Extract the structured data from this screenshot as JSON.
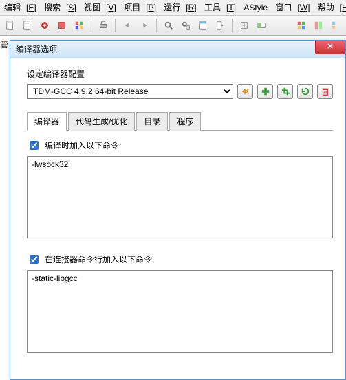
{
  "menus": {
    "edit": {
      "text": "编辑",
      "hot": "E"
    },
    "search": {
      "text": "搜索",
      "hot": "S"
    },
    "view": {
      "text": "视图",
      "hot": "V"
    },
    "project": {
      "text": "项目",
      "hot": "P"
    },
    "run": {
      "text": "运行",
      "hot": "R"
    },
    "tools": {
      "text": "工具",
      "hot": "T"
    },
    "astyle": {
      "text": "AStyle",
      "hot": ""
    },
    "window": {
      "text": "窗口",
      "hot": "W"
    },
    "help": {
      "text": "帮助",
      "hot": "H"
    }
  },
  "left_sliver": "管",
  "dialog": {
    "title": "编译器选项",
    "config_label": "设定编译器配置",
    "config_value": "TDM-GCC 4.9.2 64-bit Release",
    "tabs": {
      "compiler": "编译器",
      "codegen": "代码生成/优化",
      "dirs": "目录",
      "programs": "程序"
    },
    "compile_check_label": "编译时加入以下命令:",
    "compile_commands": "-lwsock32",
    "link_check_label": "在连接器命令行加入以下命令",
    "link_commands": "-static-libgcc"
  },
  "colors": {
    "green": "#3a9b3a",
    "orange": "#e8a23a",
    "red": "#cc4444"
  }
}
